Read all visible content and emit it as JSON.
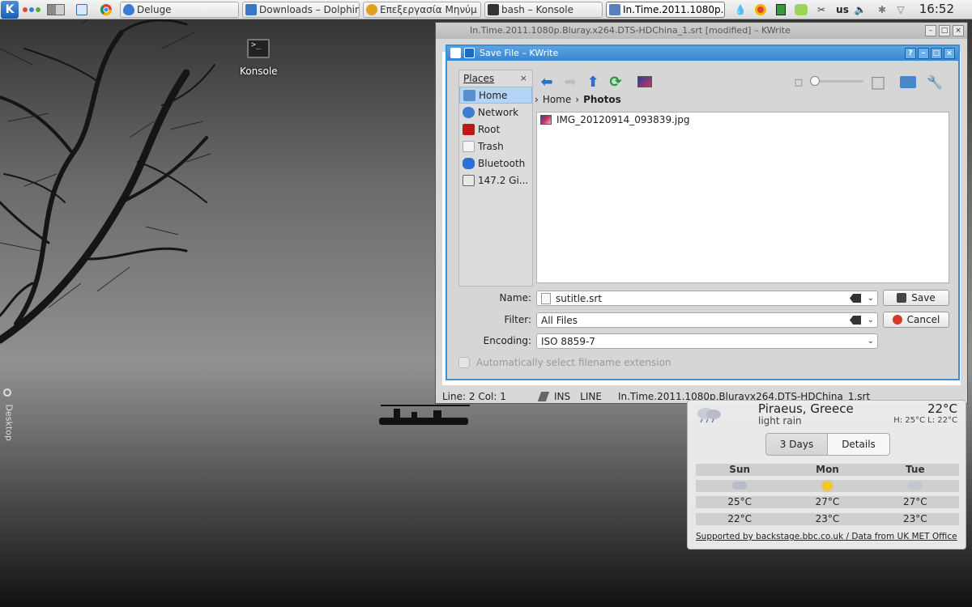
{
  "taskbar": {
    "tasks": [
      {
        "label": "Deluge",
        "icon_color": "#3a7bd5"
      },
      {
        "label": "Downloads – Dolphin",
        "icon_color": "#3b78c4"
      },
      {
        "label": "Επεξεργασία Μηνύμ",
        "icon_color": "#e0a020"
      },
      {
        "label": "bash – Konsole",
        "icon_color": "#333333"
      },
      {
        "label": "In.Time.2011.1080p.",
        "icon_color": "#5a7fbf",
        "active": true
      }
    ],
    "keyboard_layout": "us",
    "clock": "16:52"
  },
  "desktop": {
    "konsole_label": "Konsole",
    "side_label": "Desktop"
  },
  "kwrite": {
    "title": "In.Time.2011.1080p.Bluray.x264.DTS-HDChina_1.srt [modified] – KWrite",
    "status": {
      "position": "Line: 2 Col: 1",
      "mode": "INS",
      "selection": "LINE",
      "filename": "In.Time.2011.1080p.Blurayx264.DTS-HDChina_1.srt"
    }
  },
  "dialog": {
    "title": "Save File – KWrite",
    "places_header": "Places",
    "places": [
      {
        "label": "Home",
        "icon": "home-icon",
        "color": "#5b8ed0"
      },
      {
        "label": "Network",
        "icon": "network-icon",
        "color": "#3b7dd0"
      },
      {
        "label": "Root",
        "icon": "root-folder-icon",
        "color": "#c01818"
      },
      {
        "label": "Trash",
        "icon": "trash-icon",
        "color": "#e8e8e8"
      },
      {
        "label": "Bluetooth",
        "icon": "bluetooth-icon",
        "color": "#2d6fd6"
      },
      {
        "label": "147.2 Gi...",
        "icon": "drive-icon",
        "color": "#9a9a9a"
      }
    ],
    "breadcrumb": {
      "parent": "Home",
      "current": "Photos"
    },
    "files": [
      "IMG_20120914_093839.jpg"
    ],
    "name_label": "Name:",
    "name_value": "sutitle.srt",
    "filter_label": "Filter:",
    "filter_value": "All Files",
    "encoding_label": "Encoding:",
    "encoding_value": "ISO 8859-7",
    "save_label": "Save",
    "cancel_label": "Cancel",
    "auto_ext_label": "Automatically select filename extension"
  },
  "weather": {
    "city": "Piraeus, Greece",
    "condition": "light rain",
    "temperature": "22°C",
    "high_low": "H: 25°C L: 22°C",
    "tabs": [
      "3 Days",
      "Details"
    ],
    "days": [
      "Sun",
      "Mon",
      "Tue"
    ],
    "highs": [
      "25°C",
      "27°C",
      "27°C"
    ],
    "lows": [
      "22°C",
      "23°C",
      "23°C"
    ],
    "source": "Supported by backstage.bbc.co.uk / Data from UK MET Office"
  }
}
